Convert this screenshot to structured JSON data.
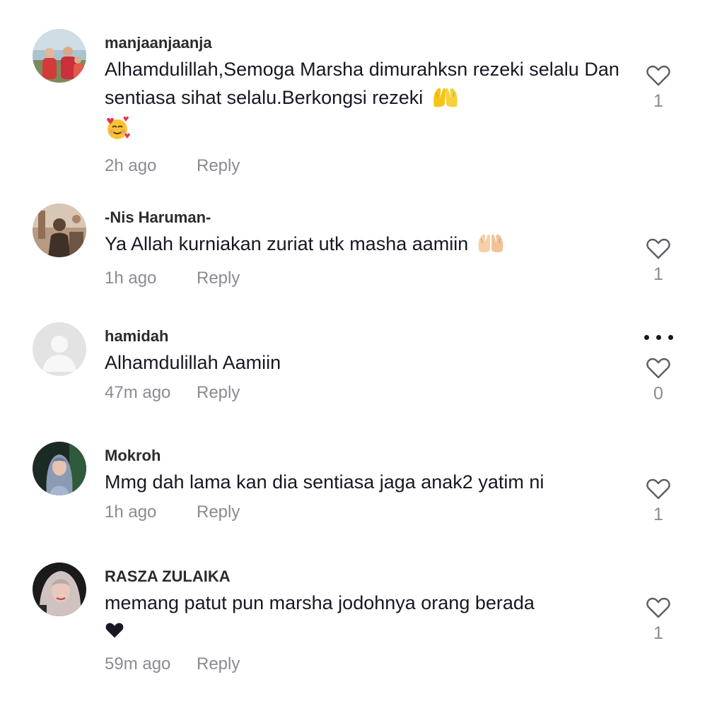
{
  "comments": [
    {
      "username": "manjaanjaanja",
      "text": "Alhamdulillah,Semoga Marsha dimurahksn rezeki selalu Dan sentiasa sihat selalu.Berkongsi rezeki",
      "time": "2h ago",
      "reply_label": "Reply",
      "likes": "1",
      "emojis": [
        "raised-hands-emoji",
        "smiling-face-with-hearts-emoji"
      ]
    },
    {
      "username": "-Nis Haruman-",
      "text": "Ya Allah kurniakan zuriat utk masha aamiin",
      "time": "1h ago",
      "reply_label": "Reply",
      "likes": "1",
      "emojis": [
        "open-hands-emoji"
      ]
    },
    {
      "username": "hamidah",
      "text": "Alhamdulillah Aamiin",
      "time": "47m ago",
      "reply_label": "Reply",
      "likes": "0",
      "emojis": []
    },
    {
      "username": "Mokroh",
      "text": "Mmg dah lama kan dia sentiasa jaga anak2 yatim ni",
      "time": "1h ago",
      "reply_label": "Reply",
      "likes": "1",
      "emojis": []
    },
    {
      "username": "RASZA ZULAIKA",
      "text": "memang patut pun marsha jodohnya orang berada",
      "time": "59m ago",
      "reply_label": "Reply",
      "likes": "1",
      "emojis": [
        "black-heart-emoji"
      ]
    }
  ],
  "icons": {
    "like": "heart-outline-icon",
    "more": "more-horizontal-icon",
    "default_avatar": "default-avatar-icon"
  },
  "colors": {
    "text": "#161823",
    "muted": "#8a8b91",
    "username": "#2b2b2b"
  }
}
